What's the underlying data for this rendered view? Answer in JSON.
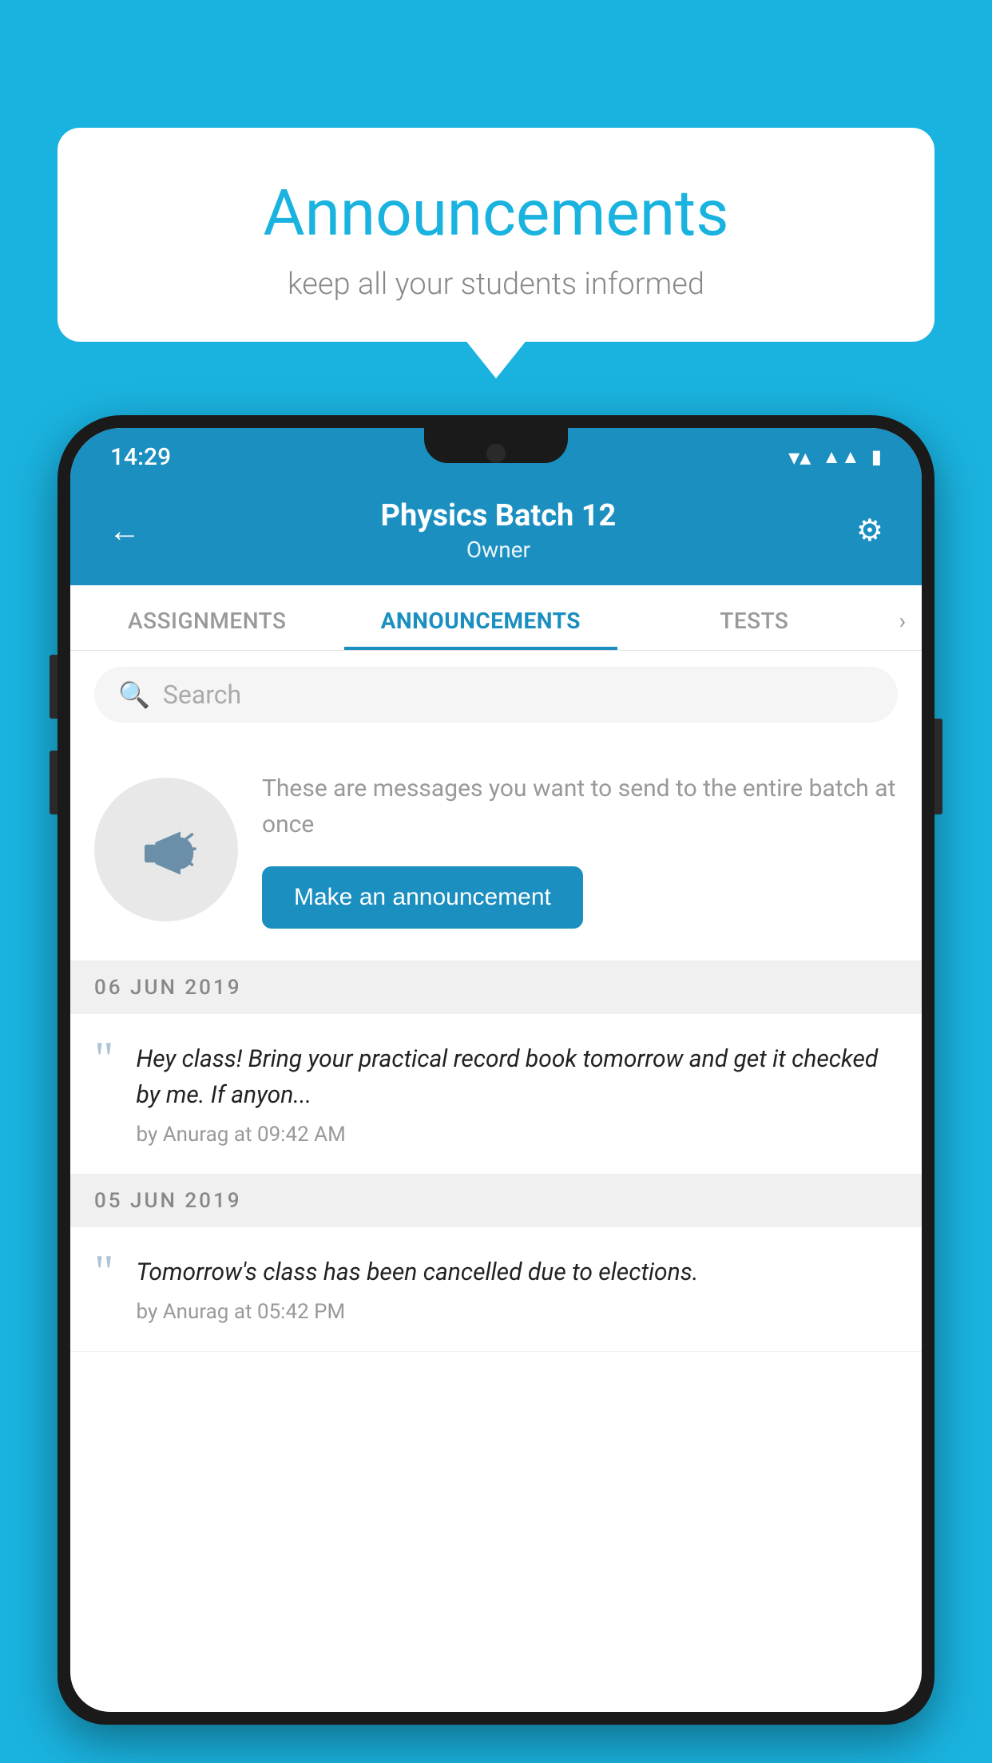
{
  "background_color": "#1ab3e0",
  "speech_bubble": {
    "title": "Announcements",
    "subtitle": "keep all your students informed"
  },
  "phone": {
    "status_bar": {
      "time": "14:29",
      "icons": [
        "wifi",
        "signal",
        "battery"
      ]
    },
    "header": {
      "title": "Physics Batch 12",
      "subtitle": "Owner",
      "back_label": "←",
      "settings_label": "⚙"
    },
    "tabs": [
      {
        "label": "ASSIGNMENTS",
        "active": false
      },
      {
        "label": "ANNOUNCEMENTS",
        "active": true
      },
      {
        "label": "TESTS",
        "active": false
      },
      {
        "label": "›",
        "active": false
      }
    ],
    "search": {
      "placeholder": "Search"
    },
    "empty_state": {
      "description": "These are messages you want to send to the entire batch at once",
      "button_label": "Make an announcement"
    },
    "date_groups": [
      {
        "date": "06  JUN  2019",
        "items": [
          {
            "text": "Hey class! Bring your practical record book tomorrow and get it checked by me. If anyon...",
            "meta": "by Anurag at 09:42 AM"
          }
        ]
      },
      {
        "date": "05  JUN  2019",
        "items": [
          {
            "text": "Tomorrow's class has been cancelled due to elections.",
            "meta": "by Anurag at 05:42 PM"
          }
        ]
      }
    ]
  }
}
